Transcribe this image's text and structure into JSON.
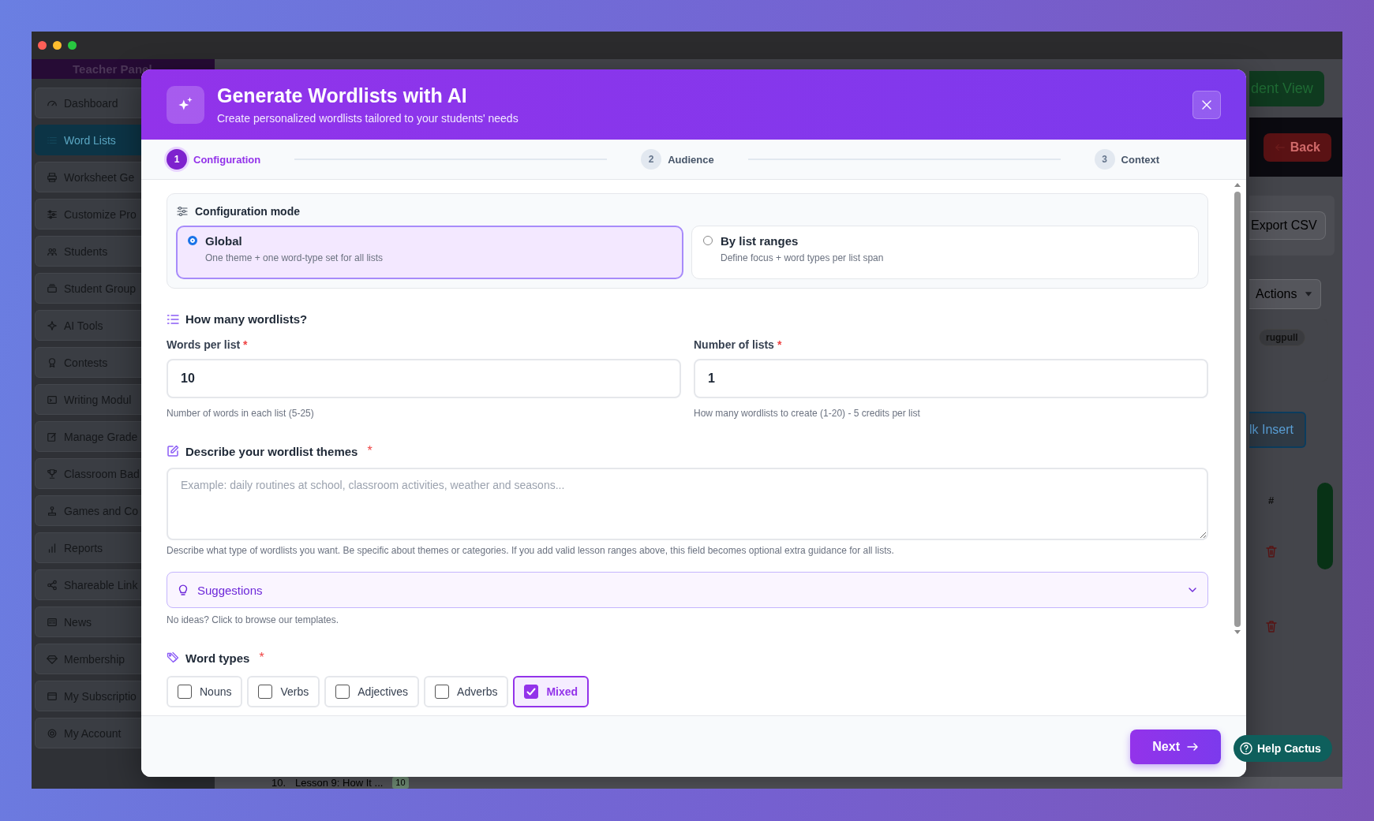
{
  "window": {
    "controls": [
      {
        "color": "#ff5f57"
      },
      {
        "color": "#febc2e"
      },
      {
        "color": "#28c840"
      }
    ]
  },
  "sidebar": {
    "title": "Teacher Panel",
    "items": [
      {
        "label": "Dashboard",
        "selected": false
      },
      {
        "label": "Word Lists",
        "selected": true
      },
      {
        "label": "Worksheet Ge",
        "selected": false
      },
      {
        "label": "Customize Pro",
        "selected": false
      },
      {
        "label": "Students",
        "selected": false
      },
      {
        "label": "Student Group",
        "selected": false
      },
      {
        "label": "AI Tools",
        "selected": false
      },
      {
        "label": "Contests",
        "selected": false
      },
      {
        "label": "Writing Modul",
        "selected": false
      },
      {
        "label": "Manage Grade",
        "selected": false
      },
      {
        "label": "Classroom Bad",
        "selected": false
      },
      {
        "label": "Games and Co",
        "selected": false
      },
      {
        "label": "Reports",
        "selected": false
      },
      {
        "label": "Shareable Link",
        "selected": false
      },
      {
        "label": "News",
        "selected": false
      },
      {
        "label": "Membership",
        "selected": false
      },
      {
        "label": "My Subscriptio",
        "selected": false
      },
      {
        "label": "My Account",
        "selected": false
      }
    ]
  },
  "background": {
    "view_button": "dent View",
    "back_button": "Back",
    "export_button": "Export CSV",
    "actions_dropdown": "Actions",
    "tag": "rugpull",
    "insert_button": "lk Insert",
    "table_header": "#",
    "row": {
      "number": "10.",
      "title": "Lesson 9: How It ...",
      "count": "10"
    }
  },
  "modal": {
    "title": "Generate Wordlists with AI",
    "subtitle": "Create personalized wordlists tailored to your students' needs",
    "steps": [
      {
        "number": "1",
        "label": "Configuration",
        "selected": true
      },
      {
        "number": "2",
        "label": "Audience",
        "selected": false
      },
      {
        "number": "3",
        "label": "Context",
        "selected": false
      }
    ],
    "config_mode": {
      "label": "Configuration mode",
      "options": [
        {
          "title": "Global",
          "description": "One theme + one word-type set for all lists",
          "selected": true
        },
        {
          "title": "By list ranges",
          "description": "Define focus + word types per list span",
          "selected": false
        }
      ]
    },
    "count_section": {
      "label": "How many wordlists?",
      "fields": [
        {
          "label": "Words per list",
          "required_mark": "*",
          "value": "10",
          "help": "Number of words in each list (5-25)"
        },
        {
          "label": "Number of lists",
          "required_mark": "*",
          "value": "1",
          "help": "How many wordlists to create (1-20) - 5 credits per list"
        }
      ]
    },
    "themes": {
      "label": "Describe your wordlist themes",
      "required_mark": "*",
      "placeholder": "Example: daily routines at school, classroom activities, weather and seasons...",
      "help": "Describe what type of wordlists you want. Be specific about themes or categories. If you add valid lesson ranges above, this field becomes optional extra guidance for all lists."
    },
    "suggestions": {
      "label": "Suggestions",
      "expanded": false,
      "help": "No ideas? Click to browse our templates."
    },
    "word_types": {
      "label": "Word types",
      "required_mark": "*",
      "options": [
        {
          "label": "Nouns",
          "checked": false
        },
        {
          "label": "Verbs",
          "checked": false
        },
        {
          "label": "Adjectives",
          "checked": false
        },
        {
          "label": "Adverbs",
          "checked": false
        },
        {
          "label": "Mixed",
          "checked": true
        }
      ]
    },
    "next_button": "Next"
  },
  "help_button": "Help Cactus"
}
